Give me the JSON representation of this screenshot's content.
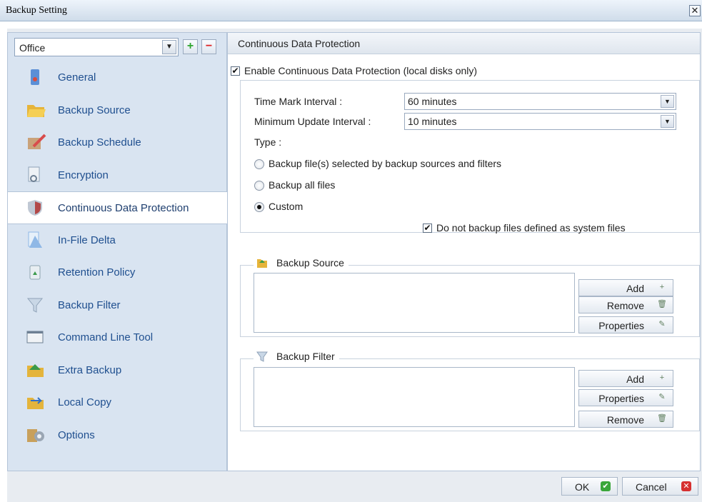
{
  "window": {
    "title": "Backup Setting",
    "close_glyph": "✕"
  },
  "profile": {
    "value": "Office",
    "add_glyph": "+",
    "remove_glyph": "−"
  },
  "nav": [
    {
      "label": "General",
      "icon": "general-icon",
      "color": "#5b8fd6"
    },
    {
      "label": "Backup Source",
      "icon": "folder-open-icon",
      "color": "#e6b43a"
    },
    {
      "label": "Backup Schedule",
      "icon": "schedule-icon",
      "color": "#c9764a"
    },
    {
      "label": "Encryption",
      "icon": "encryption-icon",
      "color": "#8fa2b8"
    },
    {
      "label": "Continuous Data Protection",
      "icon": "shield-icon",
      "color": "#b24848",
      "selected": true
    },
    {
      "label": "In-File Delta",
      "icon": "delta-icon",
      "color": "#8fb8e6"
    },
    {
      "label": "Retention Policy",
      "icon": "recycle-bin-icon",
      "color": "#9cb3a0"
    },
    {
      "label": "Backup Filter",
      "icon": "funnel-icon",
      "color": "#b8c9dc"
    },
    {
      "label": "Command Line Tool",
      "icon": "command-prompt-icon",
      "color": "#6d7f93"
    },
    {
      "label": "Extra Backup",
      "icon": "extra-backup-icon",
      "color": "#e4b43c"
    },
    {
      "label": "Local Copy",
      "icon": "local-copy-icon",
      "color": "#e4b43c"
    },
    {
      "label": "Options",
      "icon": "options-gear-icon",
      "color": "#c8a05c"
    }
  ],
  "panel": {
    "header": "Continuous Data Protection",
    "enable_label": "Enable Continuous Data Protection (local disks only)",
    "enable_checked": true,
    "time_mark_label": "Time Mark Interval :",
    "time_mark_value": "60 minutes",
    "min_update_label": "Minimum Update Interval :",
    "min_update_value": "10 minutes",
    "type_label": "Type :",
    "type_options": [
      {
        "label": "Backup file(s) selected by backup sources and filters",
        "selected": false
      },
      {
        "label": "Backup all files",
        "selected": false
      },
      {
        "label": "Custom",
        "selected": true
      }
    ],
    "system_files_label": "Do not backup files defined as system files",
    "system_files_checked": true,
    "check_glyph": "✔",
    "combo_arrow": "▼"
  },
  "backup_source": {
    "legend": "Backup Source",
    "buttons": {
      "add": "Add",
      "remove": "Remove",
      "properties": "Properties"
    }
  },
  "backup_filter": {
    "legend": "Backup Filter",
    "buttons": {
      "add": "Add",
      "properties": "Properties",
      "remove": "Remove"
    }
  },
  "button_icons": {
    "add": "+",
    "remove": "🗑",
    "properties": "✎"
  },
  "footer": {
    "ok": "OK",
    "cancel": "Cancel",
    "ok_glyph": "✔",
    "cancel_glyph": "✕",
    "ok_color": "#3aa63a",
    "cancel_color": "#d63030"
  }
}
